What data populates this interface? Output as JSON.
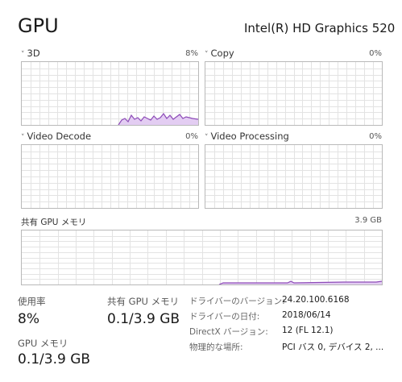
{
  "header": {
    "title": "GPU",
    "adapter_name": "Intel(R) HD Graphics 520"
  },
  "engines": [
    {
      "label": "3D",
      "percent": "8%",
      "collapse_glyph": "˅"
    },
    {
      "label": "Copy",
      "percent": "0%",
      "collapse_glyph": "˅"
    },
    {
      "label": "Video Decode",
      "percent": "0%",
      "collapse_glyph": "˅"
    },
    {
      "label": "Video Processing",
      "percent": "0%",
      "collapse_glyph": "˅"
    }
  ],
  "shared_memory_graph": {
    "label": "共有 GPU メモリ",
    "max": "3.9 GB"
  },
  "stats": {
    "utilization": {
      "label": "使用率",
      "value": "8%"
    },
    "shared_memory": {
      "label": "共有 GPU メモリ",
      "value": "0.1/3.9 GB"
    },
    "gpu_memory": {
      "label": "GPU メモリ",
      "value": "0.1/3.9 GB"
    }
  },
  "info": [
    {
      "key": "ドライバーのバージョン:",
      "value": "24.20.100.6168"
    },
    {
      "key": "ドライバーの日付:",
      "value": "2018/06/14"
    },
    {
      "key": "DirectX バージョン:",
      "value": "12 (FL 12.1)"
    },
    {
      "key": "物理的な場所:",
      "value": "PCI バス 0, デバイス 2, ..."
    }
  ],
  "colors": {
    "graph_fill": "#e3cdf2",
    "graph_line": "#8d4bb8",
    "grid": "#e3e3e3",
    "border": "#b9b9b9"
  }
}
